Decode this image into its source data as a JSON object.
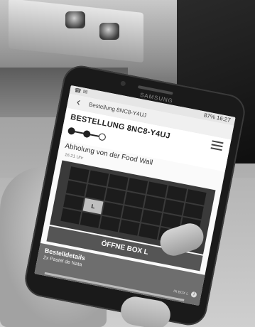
{
  "status_bar": {
    "left_icons": "☎ ✉",
    "right": "87% 16:27"
  },
  "phone": {
    "brand": "SAMSUNG"
  },
  "browser": {
    "back_icon": "arrow-left-icon",
    "back_glyph": "‹",
    "address_text": "Bestellung 8NC8-Y4UJ"
  },
  "order": {
    "title": "BESTELLUNG 8NC8-Y4UJ",
    "progress_steps": 3,
    "current_step": 3
  },
  "pickup": {
    "label": "Abholung von der Food Wall",
    "time": "16:21 Uhr"
  },
  "food_wall": {
    "columns": 7,
    "rows": 4,
    "highlighted_label": "L"
  },
  "open_button": {
    "label": "ÖFFNE BOX L"
  },
  "details": {
    "title": "Bestelldetails",
    "item": "2x Pastel de Nata",
    "right_text": "IN BOX L"
  },
  "colors": {
    "screen_bg": "#fafafa",
    "button_bg": "#555555",
    "details_bg": "#6e6e6e"
  }
}
